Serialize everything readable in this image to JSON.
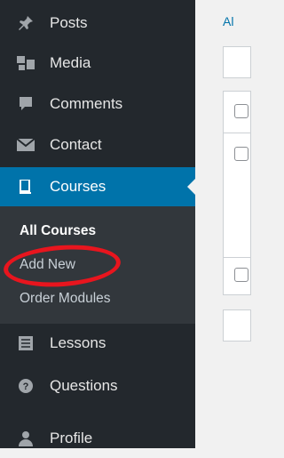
{
  "sidebar": {
    "items": [
      {
        "label": "Posts",
        "icon": "pushpin-icon"
      },
      {
        "label": "Media",
        "icon": "media-icon"
      },
      {
        "label": "Comments",
        "icon": "comment-icon"
      },
      {
        "label": "Contact",
        "icon": "envelope-icon"
      },
      {
        "label": "Courses",
        "icon": "book-icon",
        "active": true
      },
      {
        "label": "Lessons",
        "icon": "list-icon"
      },
      {
        "label": "Questions",
        "icon": "question-icon"
      },
      {
        "label": "Profile",
        "icon": "user-icon"
      }
    ],
    "submenu": [
      {
        "label": "All Courses",
        "current": true
      },
      {
        "label": "Add New"
      },
      {
        "label": "Order Modules"
      }
    ]
  },
  "content": {
    "link_text": "Al"
  },
  "colors": {
    "sidebar_bg": "#23282d",
    "submenu_bg": "#32373c",
    "active_bg": "#0073aa",
    "annotation": "#e8151e"
  }
}
